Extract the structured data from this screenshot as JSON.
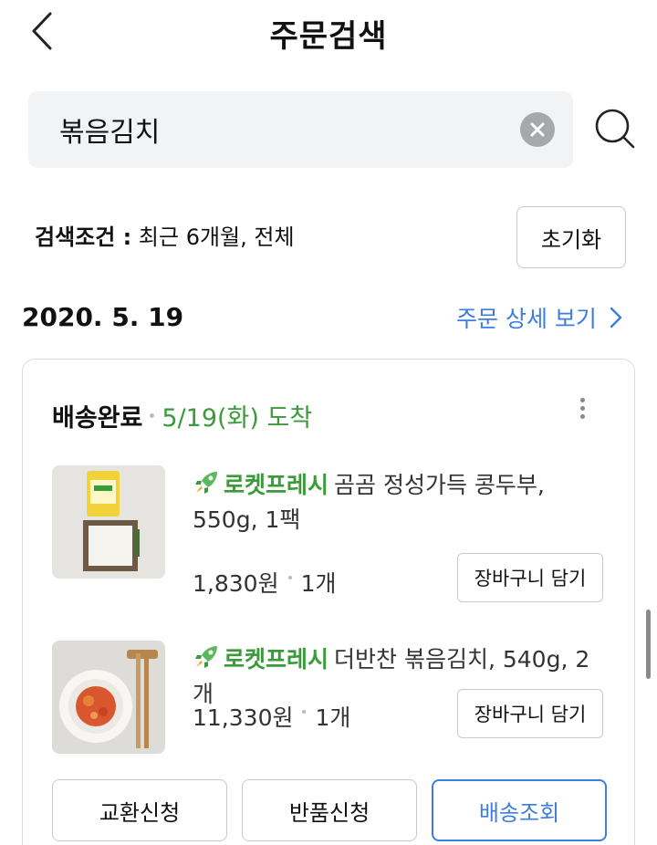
{
  "header": {
    "title": "주문검색"
  },
  "search": {
    "value": "볶음김치",
    "placeholder": ""
  },
  "conditions": {
    "label": "검색조건 :",
    "value": "최근 6개월, 전체",
    "reset_label": "초기화"
  },
  "order": {
    "date": "2020. 5. 19",
    "detail_link": "주문 상세 보기",
    "status": "배송완료",
    "arrival": "5/19(화) 도착",
    "items": [
      {
        "brand": "로켓프레시",
        "name": "곰곰 정성가득 콩두부, 550g, 1팩",
        "price": "1,830원",
        "qty": "1개",
        "cart_label": "장바구니 담기"
      },
      {
        "brand": "로켓프레시",
        "name": "더반찬 볶음김치, 540g, 2개",
        "price": "11,330원",
        "qty": "1개",
        "cart_label": "장바구니 담기"
      }
    ],
    "actions": {
      "exchange": "교환신청",
      "return": "반품신청",
      "track": "배송조회"
    }
  },
  "colors": {
    "accent_blue": "#3e7ddf",
    "fresh_green": "#3a9b3a",
    "search_bg": "#f2f3f5"
  }
}
